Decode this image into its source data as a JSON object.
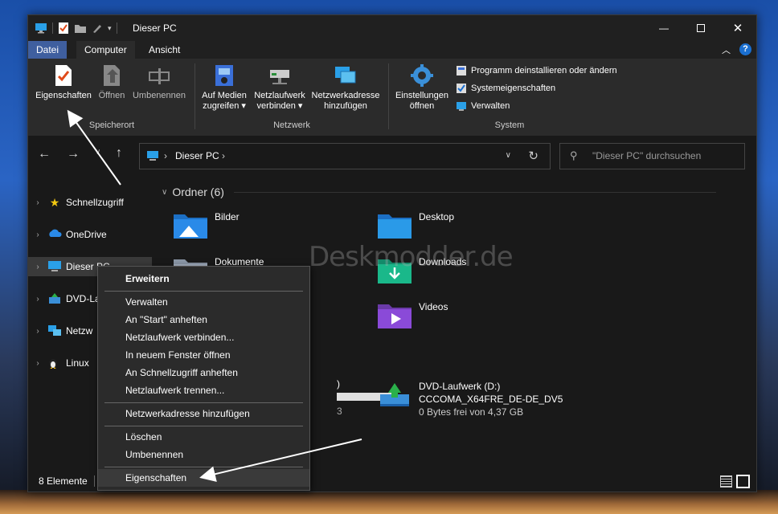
{
  "window": {
    "title": "Dieser PC"
  },
  "menu": {
    "tabs": [
      "Datei",
      "Computer",
      "Ansicht"
    ]
  },
  "ribbon": {
    "buttons": {
      "properties": "Eigenschaften",
      "open": "Öffnen",
      "rename": "Umbenennen",
      "media_1": "Auf Medien",
      "media_2": "zugreifen",
      "netdrive_1": "Netzlaufwerk",
      "netdrive_2": "verbinden",
      "netaddr_1": "Netzwerkadresse",
      "netaddr_2": "hinzufügen",
      "settings_1": "Einstellungen",
      "settings_2": "öffnen"
    },
    "system_items": [
      "Programm deinstallieren oder ändern",
      "Systemeigenschaften",
      "Verwalten"
    ],
    "groups": {
      "location": "Speicherort",
      "network": "Netzwerk",
      "system": "System"
    }
  },
  "address": {
    "path": "Dieser PC"
  },
  "search": {
    "placeholder": "\"Dieser PC\" durchsuchen"
  },
  "sidebar": {
    "items": [
      "Schnellzugriff",
      "OneDrive",
      "Dieser PC",
      "DVD-La",
      "Netzw",
      "Linux"
    ]
  },
  "main": {
    "section_title": "Ordner (6)",
    "folders": [
      "Bilder",
      "Desktop",
      "Dokumente",
      "Downloads",
      "Videos"
    ],
    "drive_partial_label": ")",
    "drive_partial_size": "3",
    "dvd": {
      "name": "DVD-Laufwerk (D:)",
      "label": "CCCOMA_X64FRE_DE-DE_DV5",
      "space": "0 Bytes frei von 4,37 GB"
    }
  },
  "context_menu": {
    "items": [
      "Erweitern",
      "Verwalten",
      "An \"Start\" anheften",
      "Netzlaufwerk verbinden...",
      "In neuem Fenster öffnen",
      "An Schnellzugriff anheften",
      "Netzlaufwerk trennen...",
      "Netzwerkadresse hinzufügen",
      "Löschen",
      "Umbenennen",
      "Eigenschaften"
    ]
  },
  "status": {
    "count": "8 Elemente"
  },
  "watermark": "Deskmodder.de"
}
